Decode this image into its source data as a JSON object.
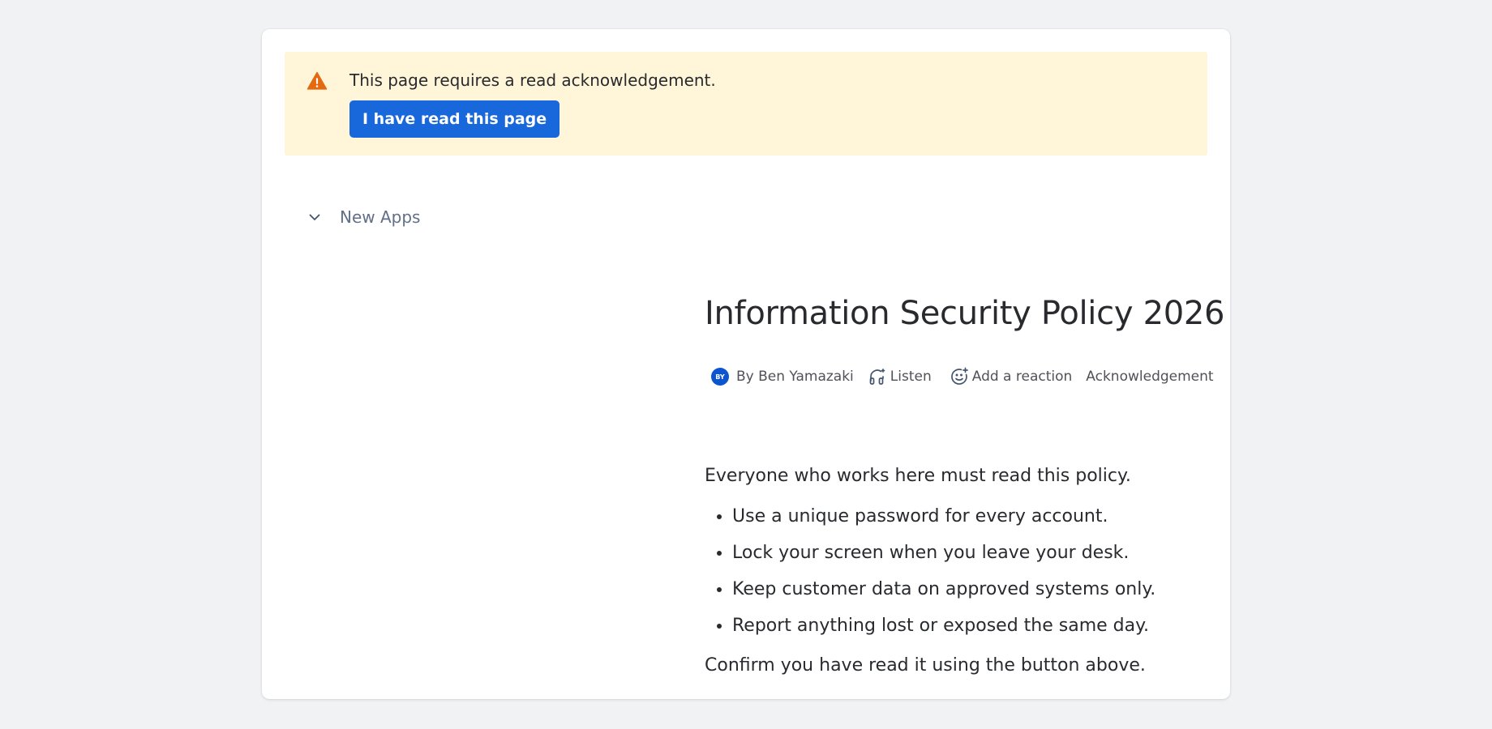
{
  "banner": {
    "message": "This page requires a read acknowledgement.",
    "button_label": "I have read this page",
    "icon": "warning-icon",
    "colors": {
      "background": "#fff5d8",
      "icon": "#e56910",
      "button": "#1868db"
    }
  },
  "tree": {
    "item_label": "New Apps",
    "icon": "chevron-down-icon"
  },
  "page": {
    "title": "Information Security Policy 2026",
    "byline": {
      "avatar_initials": "BY",
      "author": "By Ben Yamazaki",
      "listen_label": "Listen",
      "reaction_label": "Add a reaction",
      "acknowledgement_label": "Acknowledgement"
    },
    "intro": "Everyone who works here must read this policy.",
    "rules": [
      "Use a unique password for every account.",
      "Lock your screen when you leave your desk.",
      "Keep customer data on approved systems only.",
      "Report anything lost or exposed the same day."
    ],
    "closing": "Confirm you have read it using the button above."
  }
}
